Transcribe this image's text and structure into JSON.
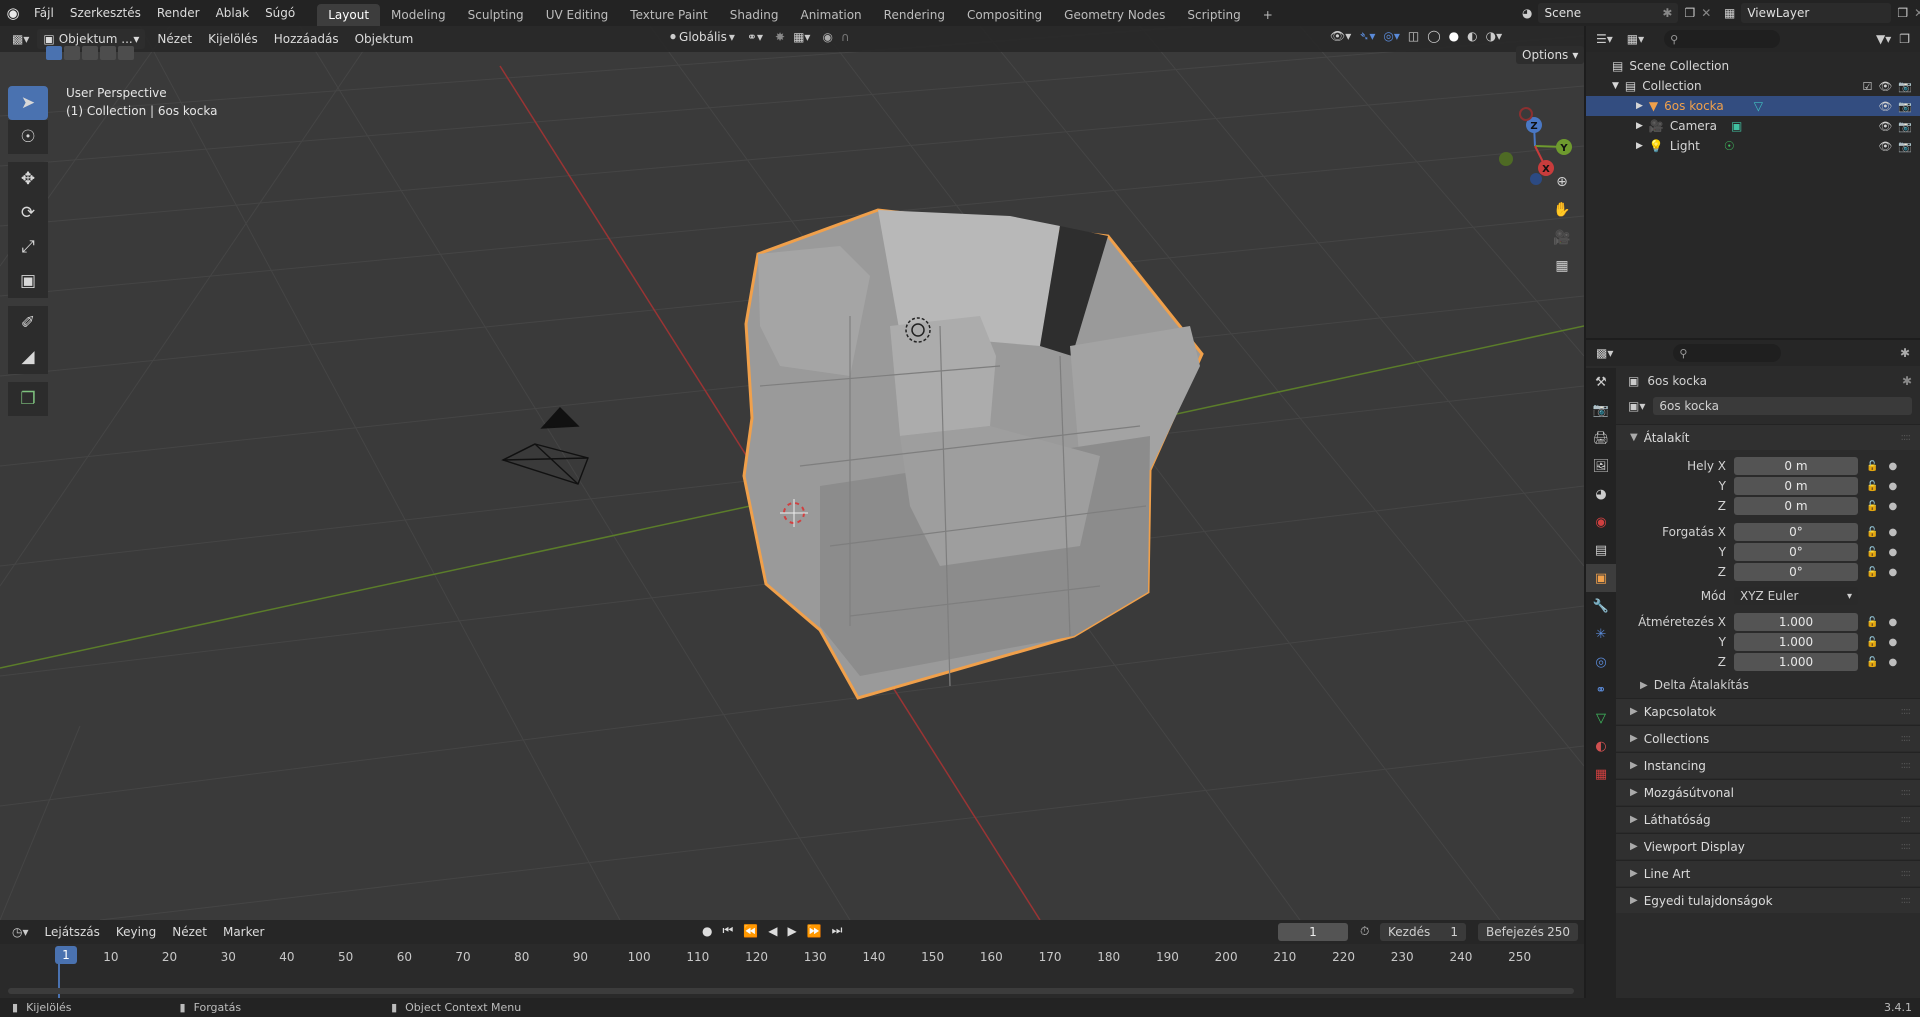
{
  "top_menu": {
    "items": [
      "Fájl",
      "Szerkesztés",
      "Render",
      "Ablak",
      "Súgó"
    ],
    "workspaces": [
      "Layout",
      "Modeling",
      "Sculpting",
      "UV Editing",
      "Texture Paint",
      "Shading",
      "Animation",
      "Rendering",
      "Compositing",
      "Geometry Nodes",
      "Scripting"
    ],
    "active_workspace": "Layout",
    "add_workspace": "+",
    "scene_name": "Scene",
    "view_layer": "ViewLayer"
  },
  "viewport": {
    "mode": "Objektum ...",
    "menus": [
      "Nézet",
      "Kijelölés",
      "Hozzáadás",
      "Objektum"
    ],
    "orientation": "Globális",
    "options": "Options",
    "perspective_label": "User Perspective",
    "collection_label": "(1) Collection | 6os kocka",
    "gizmo": {
      "x": "X",
      "y": "Y",
      "z": "Z"
    }
  },
  "outliner": {
    "root": "Scene Collection",
    "collection": "Collection",
    "objects": [
      {
        "name": "6os kocka",
        "icon": "mesh-icon",
        "selected": true
      },
      {
        "name": "Camera",
        "icon": "camera-icon",
        "selected": false
      },
      {
        "name": "Light",
        "icon": "light-icon",
        "selected": false
      }
    ]
  },
  "properties": {
    "object_name": "6os kocka",
    "data_name": "6os kocka",
    "transform_title": "Átalakít",
    "location_label": "Hely X",
    "rotation_label": "Forgatás X",
    "scale_label": "Átméretezés X",
    "y_label": "Y",
    "z_label": "Z",
    "location": [
      "0 m",
      "0 m",
      "0 m"
    ],
    "rotation": [
      "0°",
      "0°",
      "0°"
    ],
    "mode_label": "Mód",
    "mode_value": "XYZ Euler",
    "scale": [
      "1.000",
      "1.000",
      "1.000"
    ],
    "delta": "Delta Átalakítás",
    "panels": [
      "Kapcsolatok",
      "Collections",
      "Instancing",
      "Mozgásútvonal",
      "Láthatóság",
      "Viewport Display",
      "Line Art",
      "Egyedi tulajdonságok"
    ]
  },
  "timeline": {
    "menus": [
      "Lejátszás",
      "Keying",
      "Nézet",
      "Marker"
    ],
    "current_frame": "1",
    "start_label": "Kezdés",
    "start_value": "1",
    "end_label": "Befejezés",
    "end_value": "250",
    "ruler": [
      "1",
      "10",
      "20",
      "30",
      "40",
      "50",
      "60",
      "70",
      "80",
      "90",
      "100",
      "110",
      "120",
      "130",
      "140",
      "150",
      "160",
      "170",
      "180",
      "190",
      "200",
      "210",
      "220",
      "230",
      "240",
      "250"
    ]
  },
  "statusbar": {
    "select": "Kijelölés",
    "rotate": "Forgatás",
    "context": "Object Context Menu",
    "version": "3.4.1"
  },
  "colors": {
    "accent": "#4a72b0",
    "selection_orange": "#f0a04b",
    "x_axis": "#c83c3c",
    "y_axis": "#6e9a2e"
  }
}
